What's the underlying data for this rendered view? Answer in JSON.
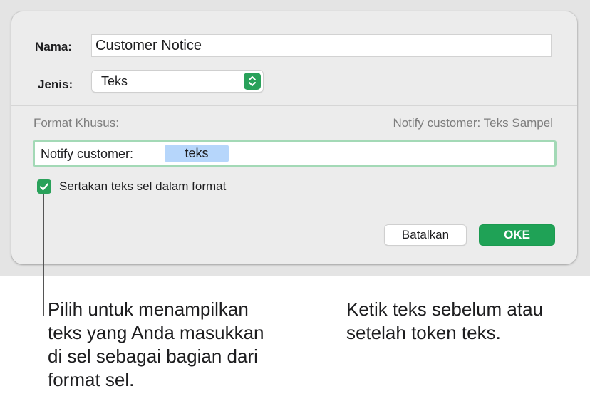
{
  "dialog": {
    "name_label": "Nama:",
    "name_value": "Customer Notice",
    "type_label": "Jenis:",
    "type_value": "Teks",
    "custom_format_label": "Format Khusus:",
    "preview": "Notify customer: Teks Sampel",
    "format_prefix": "Notify customer:",
    "format_token": "teks",
    "include_checkbox_label": "Sertakan teks sel dalam format",
    "include_checked": true,
    "cancel_label": "Batalkan",
    "ok_label": "OKE"
  },
  "callouts": {
    "checkbox_note": [
      "Pilih untuk menampilkan",
      "teks yang Anda masukkan",
      "di sel sebagai bagian dari",
      "format sel."
    ],
    "token_note": [
      "Ketik teks sebelum atau",
      "setelah token teks."
    ]
  },
  "colors": {
    "accent_green": "#29a15a",
    "token_blue": "#b6d6fb",
    "focus_ring": "#a3d9b6"
  },
  "icons": {
    "type_popup": "updown-chevron-icon",
    "checkbox": "checkmark-icon"
  }
}
